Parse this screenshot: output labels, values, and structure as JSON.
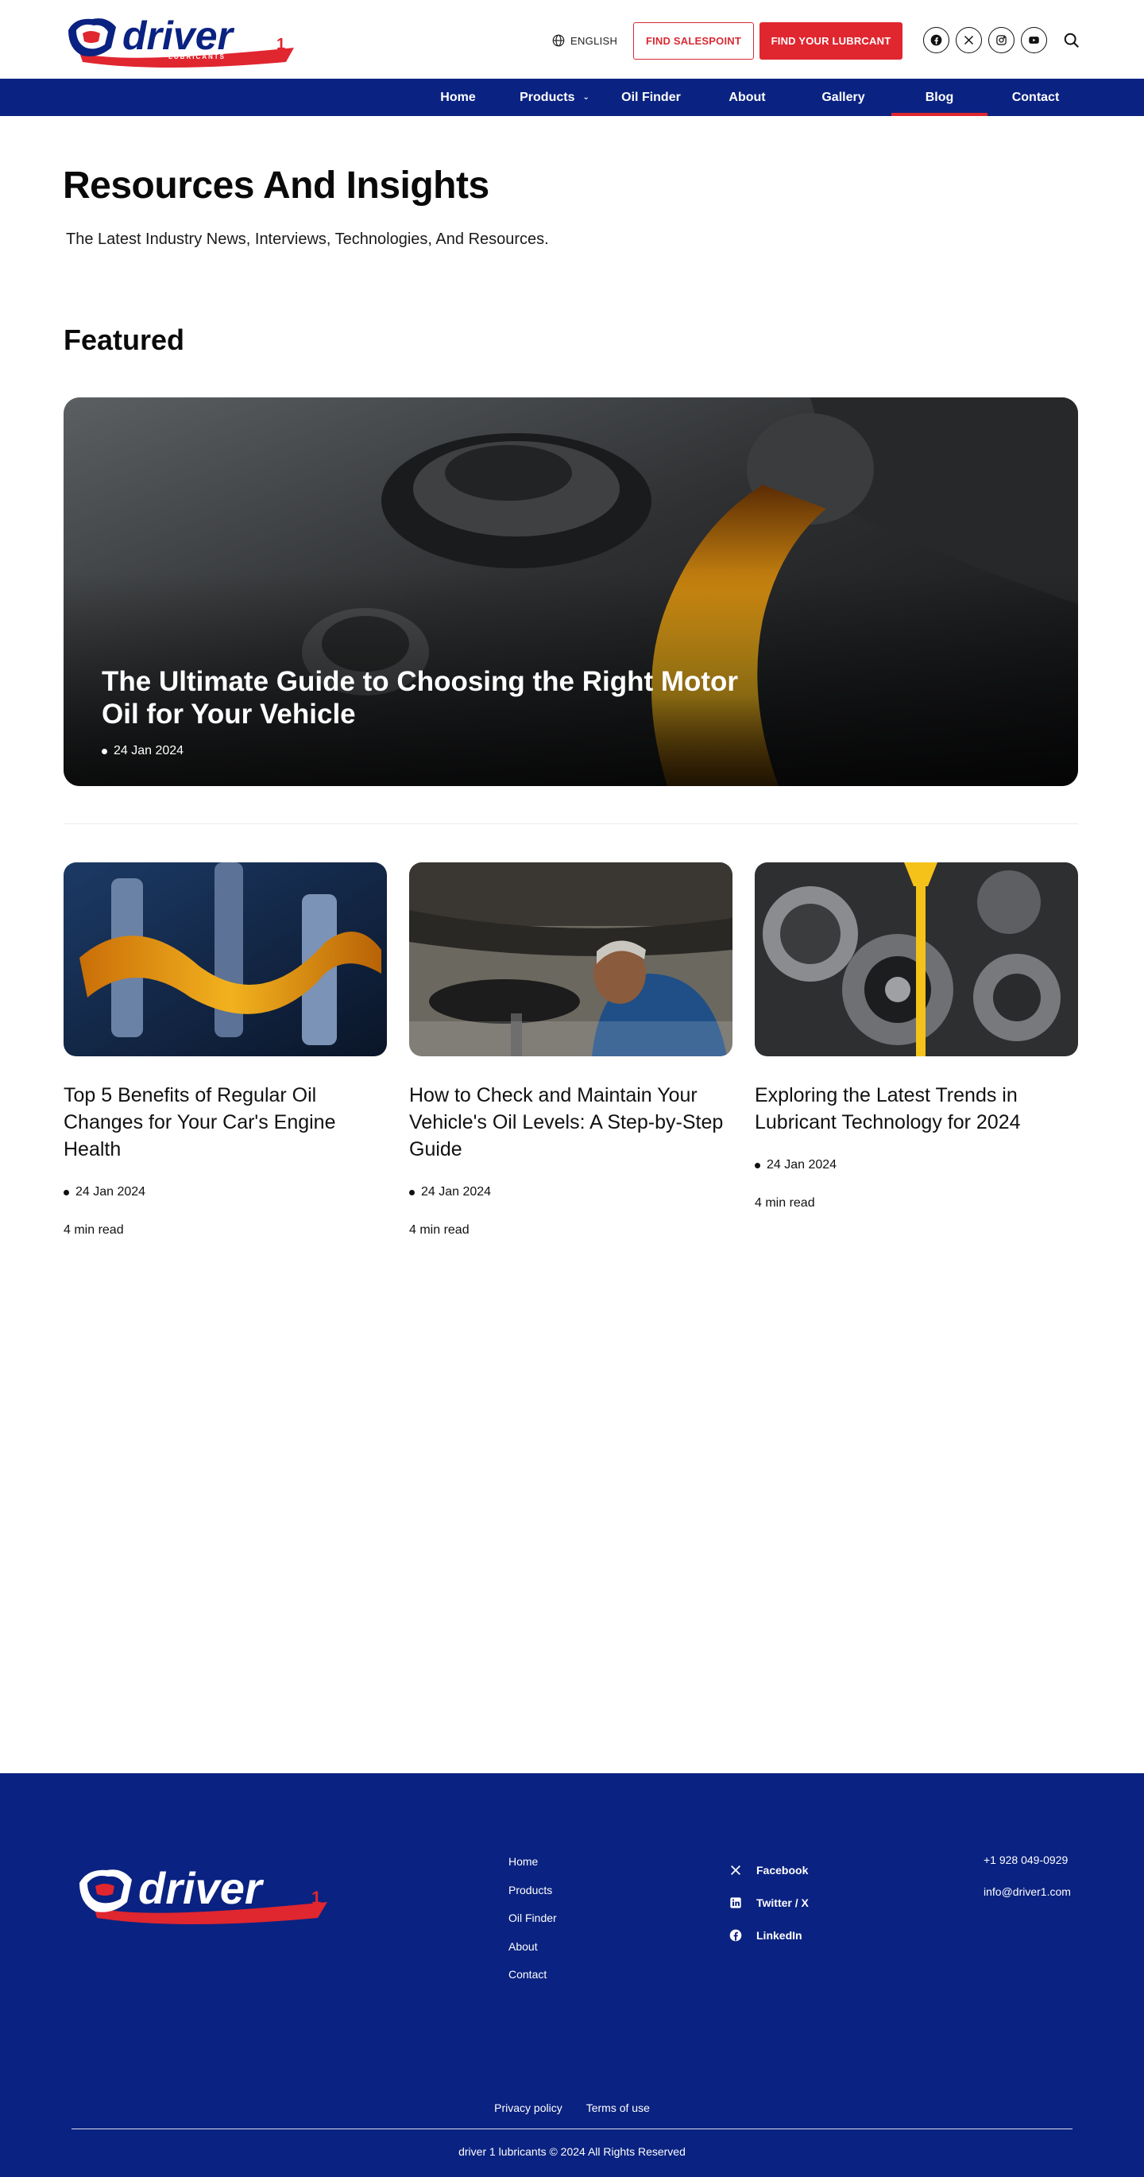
{
  "header": {
    "logo_text": "driver",
    "logo_sub": "LUBRICANTS",
    "language": "ENGLISH",
    "find_salespoint": "FIND SALESPOINT",
    "find_lubricant": "FIND YOUR LUBRCANT",
    "socials": [
      "facebook-icon",
      "x-icon",
      "instagram-icon",
      "youtube-icon"
    ]
  },
  "nav": {
    "items": [
      {
        "label": "Home"
      },
      {
        "label": "Products"
      },
      {
        "label": "Oil Finder"
      },
      {
        "label": "About"
      },
      {
        "label": "Gallery"
      },
      {
        "label": "Blog",
        "active": true
      },
      {
        "label": "Contact"
      }
    ]
  },
  "hero": {
    "title": "Resources And Insights",
    "subtitle": "The Latest Industry News, Interviews, Technologies, And Resources."
  },
  "featured": {
    "heading": "Featured",
    "title": "The Ultimate Guide to Choosing the Right Motor Oil for Your Vehicle",
    "date": "24 Jan 2024"
  },
  "articles": [
    {
      "title": "Top 5 Benefits of Regular Oil Changes for Your Car's Engine Health",
      "date": "24 Jan 2024",
      "read": "4 min read"
    },
    {
      "title": "How to Check and Maintain Your Vehicle's Oil Levels: A Step-by-Step Guide",
      "date": "24 Jan 2024",
      "read": "4 min read"
    },
    {
      "title": "Exploring the Latest Trends in Lubricant Technology for 2024",
      "date": "24 Jan 2024",
      "read": "4 min read"
    }
  ],
  "footer": {
    "links": [
      "Home",
      "Products",
      "Oil Finder",
      "About",
      "Contact"
    ],
    "social": [
      {
        "icon": "x-icon",
        "label": "Facebook"
      },
      {
        "icon": "linkedin-icon",
        "label": "Twitter / X"
      },
      {
        "icon": "facebook-icon",
        "label": "LinkedIn"
      }
    ],
    "phone": "+1 928 049-0929",
    "email": "info@driver1.com",
    "privacy": "Privacy policy",
    "terms": "Terms of use",
    "copyright": "driver 1 lubricants © 2024 All Rights Reserved"
  },
  "colors": {
    "brand_blue": "#0a2281",
    "brand_red": "#e0262f"
  }
}
